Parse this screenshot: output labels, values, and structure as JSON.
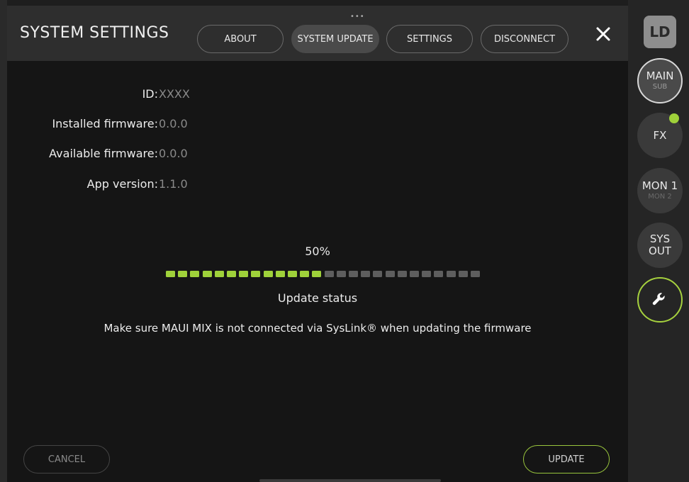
{
  "header": {
    "title": "SYSTEM SETTINGS",
    "tabs": [
      {
        "label": "ABOUT",
        "active": false
      },
      {
        "label": "SYSTEM UPDATE",
        "active": true
      },
      {
        "label": "SETTINGS",
        "active": false
      },
      {
        "label": "DISCONNECT",
        "active": false
      }
    ],
    "close_icon": "close-x-icon",
    "grip_icon": "drag-grip-icon"
  },
  "info": [
    {
      "label": "ID:",
      "value": "XXXX"
    },
    {
      "label": "Installed firmware:",
      "value": "0.0.0"
    },
    {
      "label": "Available firmware:",
      "value": "0.0.0"
    },
    {
      "label": "App version:",
      "value": "1.1.0"
    }
  ],
  "update": {
    "percent_text": "50%",
    "progress_fraction": 0.5,
    "segment_count": 26,
    "status": "Update status",
    "warning": "Make sure MAUI MIX is not connected via SysLink® when updating the firmware"
  },
  "footer": {
    "cancel_label": "CANCEL",
    "update_label": "UPDATE"
  },
  "sidebar": {
    "logo": "LD",
    "items": [
      {
        "main": "MAIN",
        "sub": "SUB"
      },
      {
        "main": "FX",
        "sub": ""
      },
      {
        "main": "MON 1",
        "sub": "MON 2"
      },
      {
        "main": "SYS",
        "sub": "OUT"
      }
    ],
    "tools_icon": "wrench-icon"
  },
  "colors": {
    "accent_green": "#9fd13a",
    "progress_off": "#5e5e5e",
    "panel": "#151515"
  }
}
